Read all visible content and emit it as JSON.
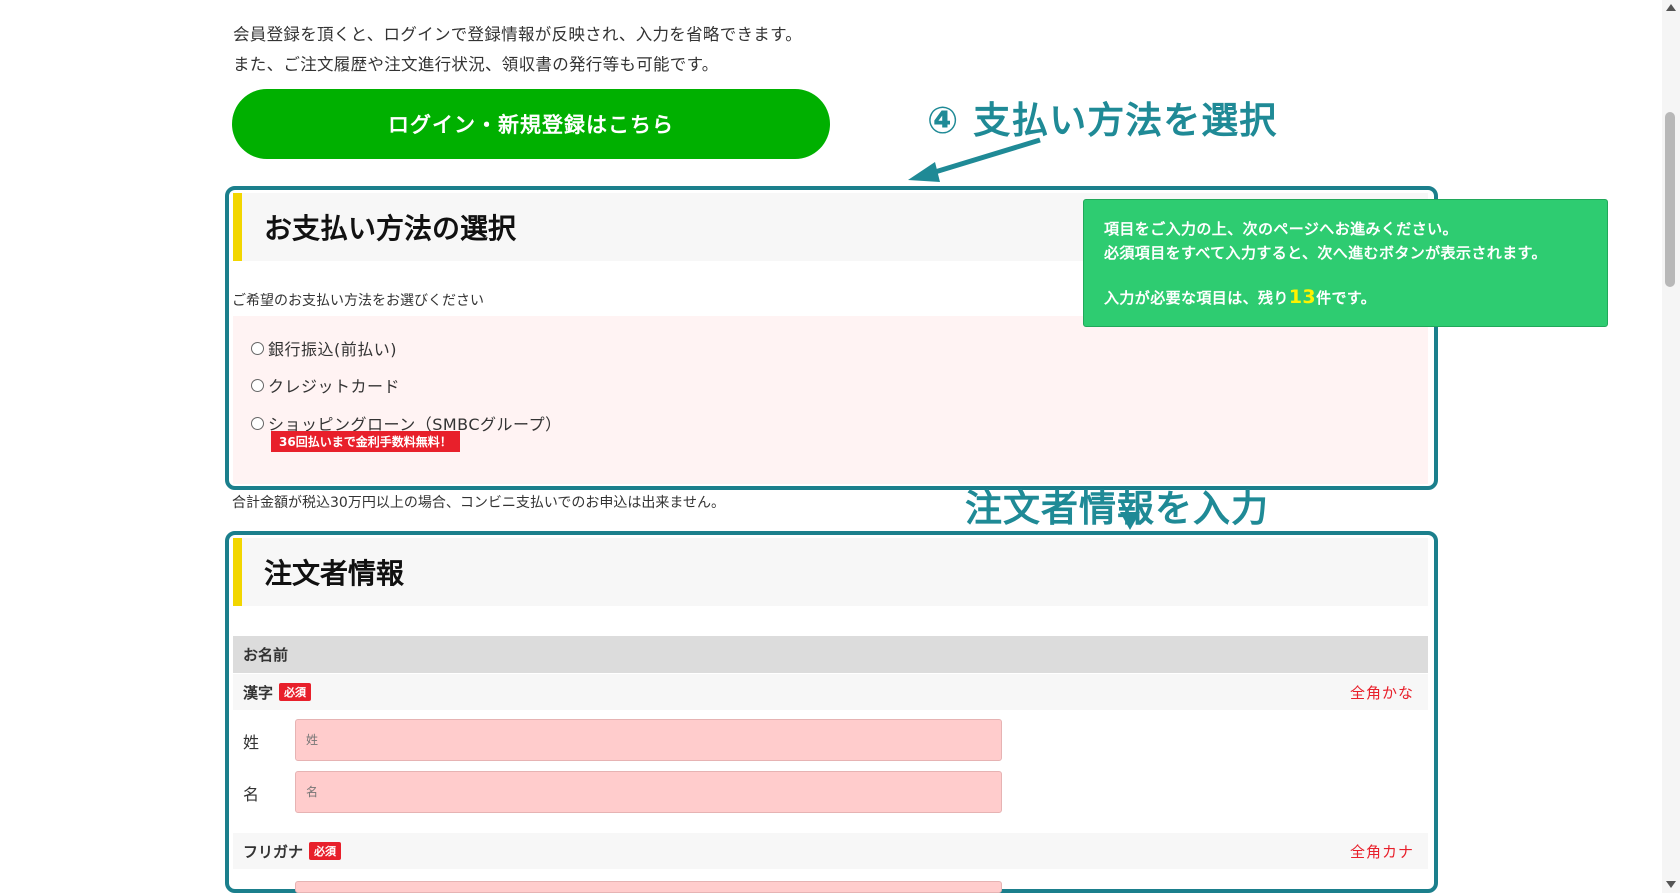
{
  "intro": {
    "line1": "会員登録を頂くと、ログインで登録情報が反映され、入力を省略できます。",
    "line2": "また、ご注文履歴や注文進行状況、領収書の発行等も可能です。"
  },
  "login_button": "ログイン・新規登録はこちら",
  "annotations": {
    "step4": "④ 支払い方法を選択",
    "orderer": "注文者情報を入力",
    "color": "#1f8a96"
  },
  "payment": {
    "title": "お支払い方法の選択",
    "prompt": "ご希望のお支払い方法をお選びください",
    "options": [
      {
        "label": "銀行振込(前払い)"
      },
      {
        "label": "クレジットカード"
      },
      {
        "label": "ショッピングローン（SMBCグループ）"
      }
    ],
    "promo": "36回払いまで金利手数料無料！",
    "note": "合計金額が税込30万円以上の場合、コンビニ支払いでのお申込は出来ません。"
  },
  "tooltip": {
    "line1": "項目をご入力の上、次のページへお進みください。",
    "line2": "必須項目をすべて入力すると、次へ進むボタンが表示されます。",
    "remaining_prefix": "入力が必要な項目は、残り",
    "remaining_count": "13",
    "remaining_suffix": "件です。"
  },
  "orderer": {
    "title": "注文者情報",
    "name_header": "お名前",
    "kanji": {
      "label": "漢字",
      "required": "必須",
      "hint": "全角かな"
    },
    "sei": {
      "label": "姓",
      "placeholder": "姓"
    },
    "mei": {
      "label": "名",
      "placeholder": "名"
    },
    "kana": {
      "label": "フリガナ",
      "required": "必須",
      "hint": "全角カナ"
    }
  },
  "colors": {
    "accent_green": "#00b000",
    "frame_teal": "#1b7f8c",
    "required_red": "#e8202b",
    "tooltip_green": "#2ecc71",
    "section_bar_yellow": "#f2d600"
  }
}
